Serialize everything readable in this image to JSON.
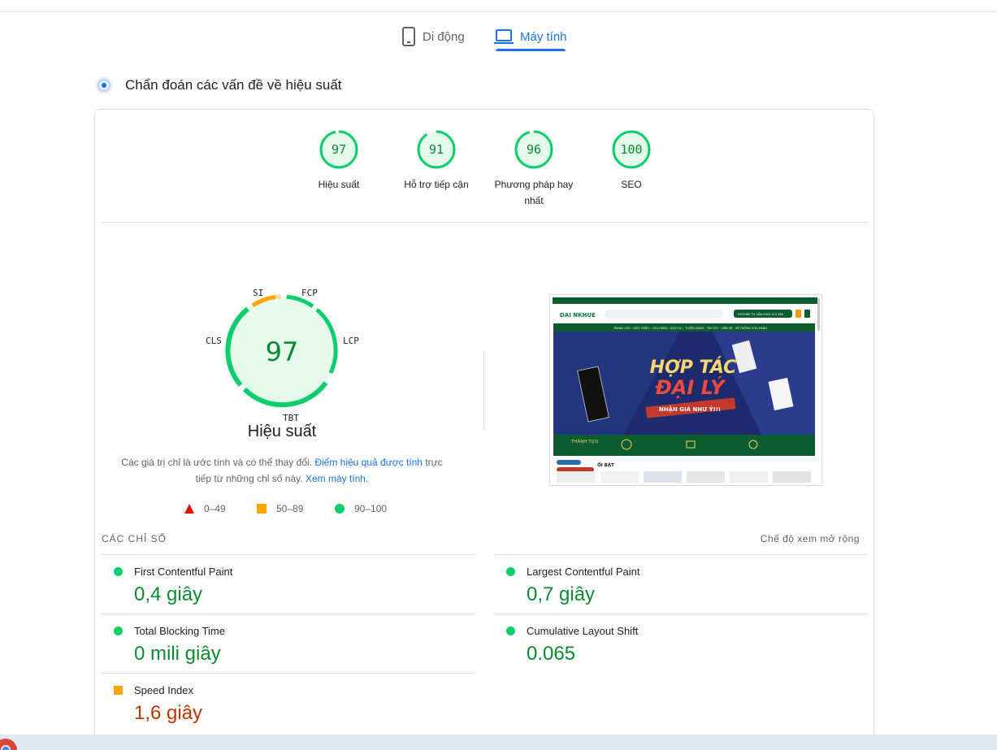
{
  "tabs": [
    {
      "label": "Di động",
      "icon": "smartphone-icon",
      "active": false
    },
    {
      "label": "Máy tính",
      "icon": "laptop-icon",
      "active": true
    }
  ],
  "section": {
    "title": "Chẩn đoán các vấn đề về hiệu suất",
    "icon": "diagnostics-icon"
  },
  "categories": [
    {
      "score": 97,
      "label": "Hiệu suất"
    },
    {
      "score": 91,
      "label": "Hỗ trợ tiếp cận"
    },
    {
      "score": 96,
      "label": "Phương pháp hay nhất"
    },
    {
      "score": 100,
      "label": "SEO"
    }
  ],
  "performance": {
    "score": 97,
    "title": "Hiệu suất",
    "metric_labels": {
      "si": "SI",
      "fcp": "FCP",
      "lcp": "LCP",
      "cls": "CLS",
      "tbt": "TBT"
    },
    "note_prefix": "Các giá trị chỉ là ước tính và có thể thay đổi.",
    "note_link": "Điểm hiệu quả được tính",
    "note_mid": "trực tiếp từ những chỉ số này.",
    "note_link2": "Xem máy tính."
  },
  "legend": {
    "fail": "0–49",
    "average": "50–89",
    "pass": "90–100"
  },
  "colors": {
    "pass": "#0cce6b",
    "average": "#ffa400",
    "fail": "#ff4e42",
    "accent": "#1a73e8"
  },
  "metrics": {
    "heading": "CÁC CHỈ SỐ",
    "expand": "Chế độ xem mở rộng",
    "items": [
      {
        "name": "First Contentful Paint",
        "value": "0,4 giây",
        "rating": "pass"
      },
      {
        "name": "Largest Contentful Paint",
        "value": "0,7 giây",
        "rating": "pass"
      },
      {
        "name": "Total Blocking Time",
        "value": "0 mili giây",
        "rating": "pass"
      },
      {
        "name": "Cumulative Layout Shift",
        "value": "0.065",
        "rating": "pass"
      },
      {
        "name": "Speed Index",
        "value": "1,6 giây",
        "rating": "average"
      }
    ]
  },
  "preview": {
    "logo": "DAI NKHUE",
    "hotline": "HOTLINE TƯ VẤN 0909 123 456",
    "nav": [
      "TRANG CHỦ",
      "GIỚI THIỆU",
      "CỬA HÀNG",
      "DỊCH VỤ",
      "TUYỂN DỤNG",
      "TIN TỨC",
      "LIÊN HỆ",
      "HỆ THỐNG CỬA HÀNG"
    ],
    "banner_line1": "HỢP TÁC",
    "banner_line2": "ĐẠI LÝ",
    "banner_ribbon": "NHẬN GIÁ NHƯ Ý!!!",
    "stats_title": "THÀNH TỰU",
    "products_title": "ỔI BẬT"
  }
}
